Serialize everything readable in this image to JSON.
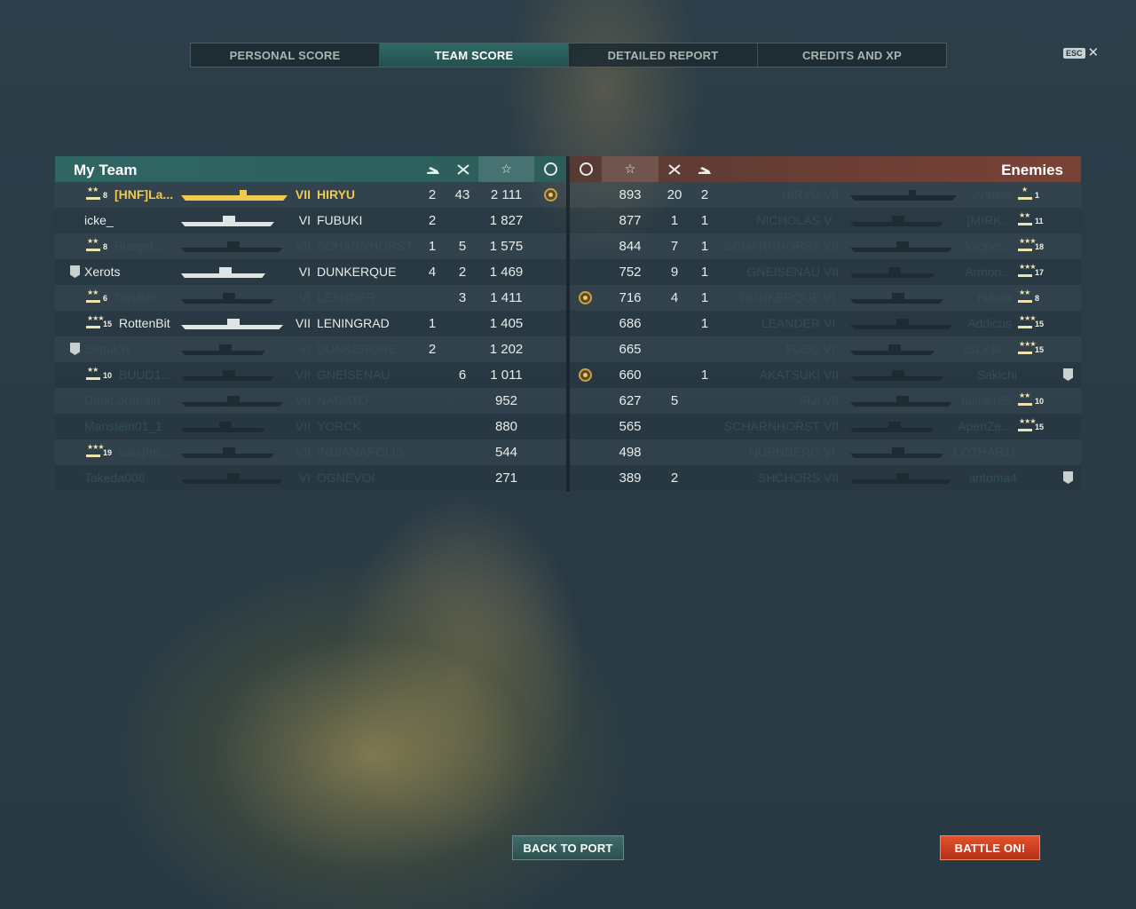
{
  "tabs": [
    {
      "label": "PERSONAL SCORE",
      "active": false
    },
    {
      "label": "TEAM SCORE",
      "active": true
    },
    {
      "label": "DETAILED REPORT",
      "active": false
    },
    {
      "label": "CREDITS AND XP",
      "active": false
    }
  ],
  "esc_label": "ESC",
  "my_team": {
    "title": "My Team",
    "rows": [
      {
        "rank": "8",
        "name": "[HNF]La...",
        "tier": "VII",
        "ship": "HIRYU",
        "planes": "2",
        "damage": "43",
        "xp": "2 111",
        "medal": true,
        "state": "me",
        "badge": false
      },
      {
        "rank": "",
        "name": "icke_",
        "tier": "VI",
        "ship": "FUBUKI",
        "planes": "2",
        "damage": "",
        "xp": "1 827",
        "medal": false,
        "state": "alive",
        "badge": false
      },
      {
        "rank": "8",
        "name": "Buegel...",
        "tier": "VII",
        "ship": "SCHARNHORST",
        "planes": "1",
        "damage": "5",
        "xp": "1 575",
        "medal": false,
        "state": "dim",
        "badge": false
      },
      {
        "rank": "",
        "name": "Xerots",
        "tier": "VI",
        "ship": "DUNKERQUE",
        "planes": "4",
        "damage": "2",
        "xp": "1 469",
        "medal": false,
        "state": "alive",
        "badge": true
      },
      {
        "rank": "6",
        "name": "DasBer...",
        "tier": "VI",
        "ship": "LEANDER",
        "planes": "",
        "damage": "3",
        "xp": "1 411",
        "medal": false,
        "state": "dim",
        "badge": false
      },
      {
        "rank": "15",
        "name": "RottenBit",
        "tier": "VII",
        "ship": "LENINGRAD",
        "planes": "1",
        "damage": "",
        "xp": "1 405",
        "medal": false,
        "state": "alive",
        "badge": false
      },
      {
        "rank": "",
        "name": "Sepulch",
        "tier": "VI",
        "ship": "DUNKERQUE",
        "planes": "2",
        "damage": "",
        "xp": "1 202",
        "medal": false,
        "state": "dim",
        "badge": true
      },
      {
        "rank": "10",
        "name": "BUUD1...",
        "tier": "VII",
        "ship": "GNEISENAU",
        "planes": "",
        "damage": "6",
        "xp": "1 011",
        "medal": false,
        "state": "dim",
        "badge": false
      },
      {
        "rank": "",
        "name": "DarkLordKain",
        "tier": "VII",
        "ship": "NAGATO",
        "planes": "",
        "damage": "",
        "xp": "952",
        "medal": false,
        "state": "dim",
        "badge": false
      },
      {
        "rank": "",
        "name": "Manstein01_1",
        "tier": "VII",
        "ship": "YORCK",
        "planes": "",
        "damage": "",
        "xp": "880",
        "medal": false,
        "state": "dim",
        "badge": false
      },
      {
        "rank": "19",
        "name": "vaughn...",
        "tier": "VII",
        "ship": "INDIANAPOLIS",
        "planes": "",
        "damage": "",
        "xp": "544",
        "medal": false,
        "state": "dim",
        "badge": false
      },
      {
        "rank": "",
        "name": "Takeda008",
        "tier": "VI",
        "ship": "OGNEVOI",
        "planes": "",
        "damage": "",
        "xp": "271",
        "medal": false,
        "state": "dim",
        "badge": false
      }
    ]
  },
  "enemies": {
    "title": "Enemies",
    "rows": [
      {
        "medal": false,
        "xp": "893",
        "damage": "20",
        "planes": "2",
        "ship": "HIRYU",
        "tier": "VII",
        "name": "Anukat",
        "rank": "1",
        "badge": false
      },
      {
        "medal": false,
        "xp": "877",
        "damage": "1",
        "planes": "1",
        "ship": "NICHOLAS",
        "tier": "V",
        "name": "[MIRK...",
        "rank": "11",
        "badge": false
      },
      {
        "medal": false,
        "xp": "844",
        "damage": "7",
        "planes": "1",
        "ship": "SCHARNHORST",
        "tier": "VII",
        "name": "loicpet...",
        "rank": "18",
        "badge": false
      },
      {
        "medal": false,
        "xp": "752",
        "damage": "9",
        "planes": "1",
        "ship": "GNEISENAU",
        "tier": "VII",
        "name": "Armon...",
        "rank": "17",
        "badge": false
      },
      {
        "medal": true,
        "xp": "716",
        "damage": "4",
        "planes": "1",
        "ship": "DUNKERQUE",
        "tier": "VI",
        "name": "ni4ata",
        "rank": "8",
        "badge": false
      },
      {
        "medal": false,
        "xp": "686",
        "damage": "",
        "planes": "1",
        "ship": "LEANDER",
        "tier": "VI",
        "name": "Addicus",
        "rank": "15",
        "badge": false
      },
      {
        "medal": false,
        "xp": "665",
        "damage": "",
        "planes": "",
        "ship": "FUSO",
        "tier": "VI",
        "name": "[SLK]a...",
        "rank": "15",
        "badge": false
      },
      {
        "medal": true,
        "xp": "660",
        "damage": "",
        "planes": "1",
        "ship": "AKATSUKI",
        "tier": "VII",
        "name": "Sakichi",
        "rank": "",
        "badge": true
      },
      {
        "medal": false,
        "xp": "627",
        "damage": "5",
        "planes": "",
        "ship": "FIJI",
        "tier": "VII",
        "name": "fuchs165",
        "rank": "10",
        "badge": false
      },
      {
        "medal": false,
        "xp": "565",
        "damage": "",
        "planes": "",
        "ship": "SCHARNHORST",
        "tier": "VII",
        "name": "ApenZe...",
        "rank": "15",
        "badge": false
      },
      {
        "medal": false,
        "xp": "498",
        "damage": "",
        "planes": "",
        "ship": "NÜRNBERG",
        "tier": "VI",
        "name": "LOTHAR11",
        "rank": "",
        "badge": false
      },
      {
        "medal": false,
        "xp": "389",
        "damage": "2",
        "planes": "",
        "ship": "SHCHORS",
        "tier": "VII",
        "name": "antoma4",
        "rank": "",
        "badge": true
      }
    ]
  },
  "buttons": {
    "back_to_port": "BACK TO PORT",
    "battle_on": "BATTLE ON!"
  },
  "colors": {
    "my_team_header": "#2f6663",
    "enemies_header": "#7a4236",
    "me_highlight": "#f2c94c",
    "battle_button": "#d2421f"
  }
}
